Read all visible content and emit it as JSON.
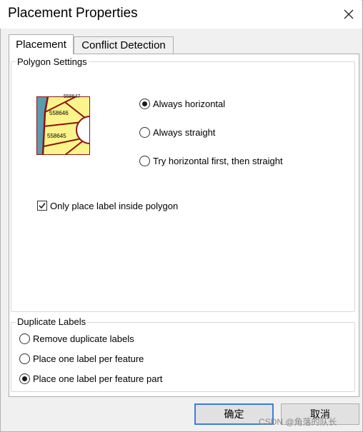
{
  "dialog": {
    "title": "Placement Properties"
  },
  "tabs": [
    {
      "label": "Placement",
      "active": true
    },
    {
      "label": "Conflict Detection",
      "active": false
    }
  ],
  "polygon_settings": {
    "legend": "Polygon Settings",
    "preview_labels": [
      "558647",
      "558646",
      "558645"
    ],
    "options": [
      {
        "label": "Always horizontal",
        "selected": true
      },
      {
        "label": "Always straight",
        "selected": false
      },
      {
        "label": "Try horizontal first, then straight",
        "selected": false
      }
    ],
    "inside_polygon": {
      "label": "Only place label inside polygon",
      "checked": true
    }
  },
  "duplicate_labels": {
    "legend": "Duplicate Labels",
    "options": [
      {
        "label": "Remove duplicate labels",
        "selected": false
      },
      {
        "label": "Place one label per feature",
        "selected": false
      },
      {
        "label": "Place one label per feature part",
        "selected": true
      }
    ]
  },
  "buttons": {
    "ok": "确定",
    "cancel": "取消"
  },
  "watermark": "CSDN @角落的队长",
  "colors": {
    "polygon_fill": "#fbf48a",
    "polygon_border": "#8b1414",
    "water": "#5a9bb0",
    "focus_border": "#3c7fd4"
  }
}
